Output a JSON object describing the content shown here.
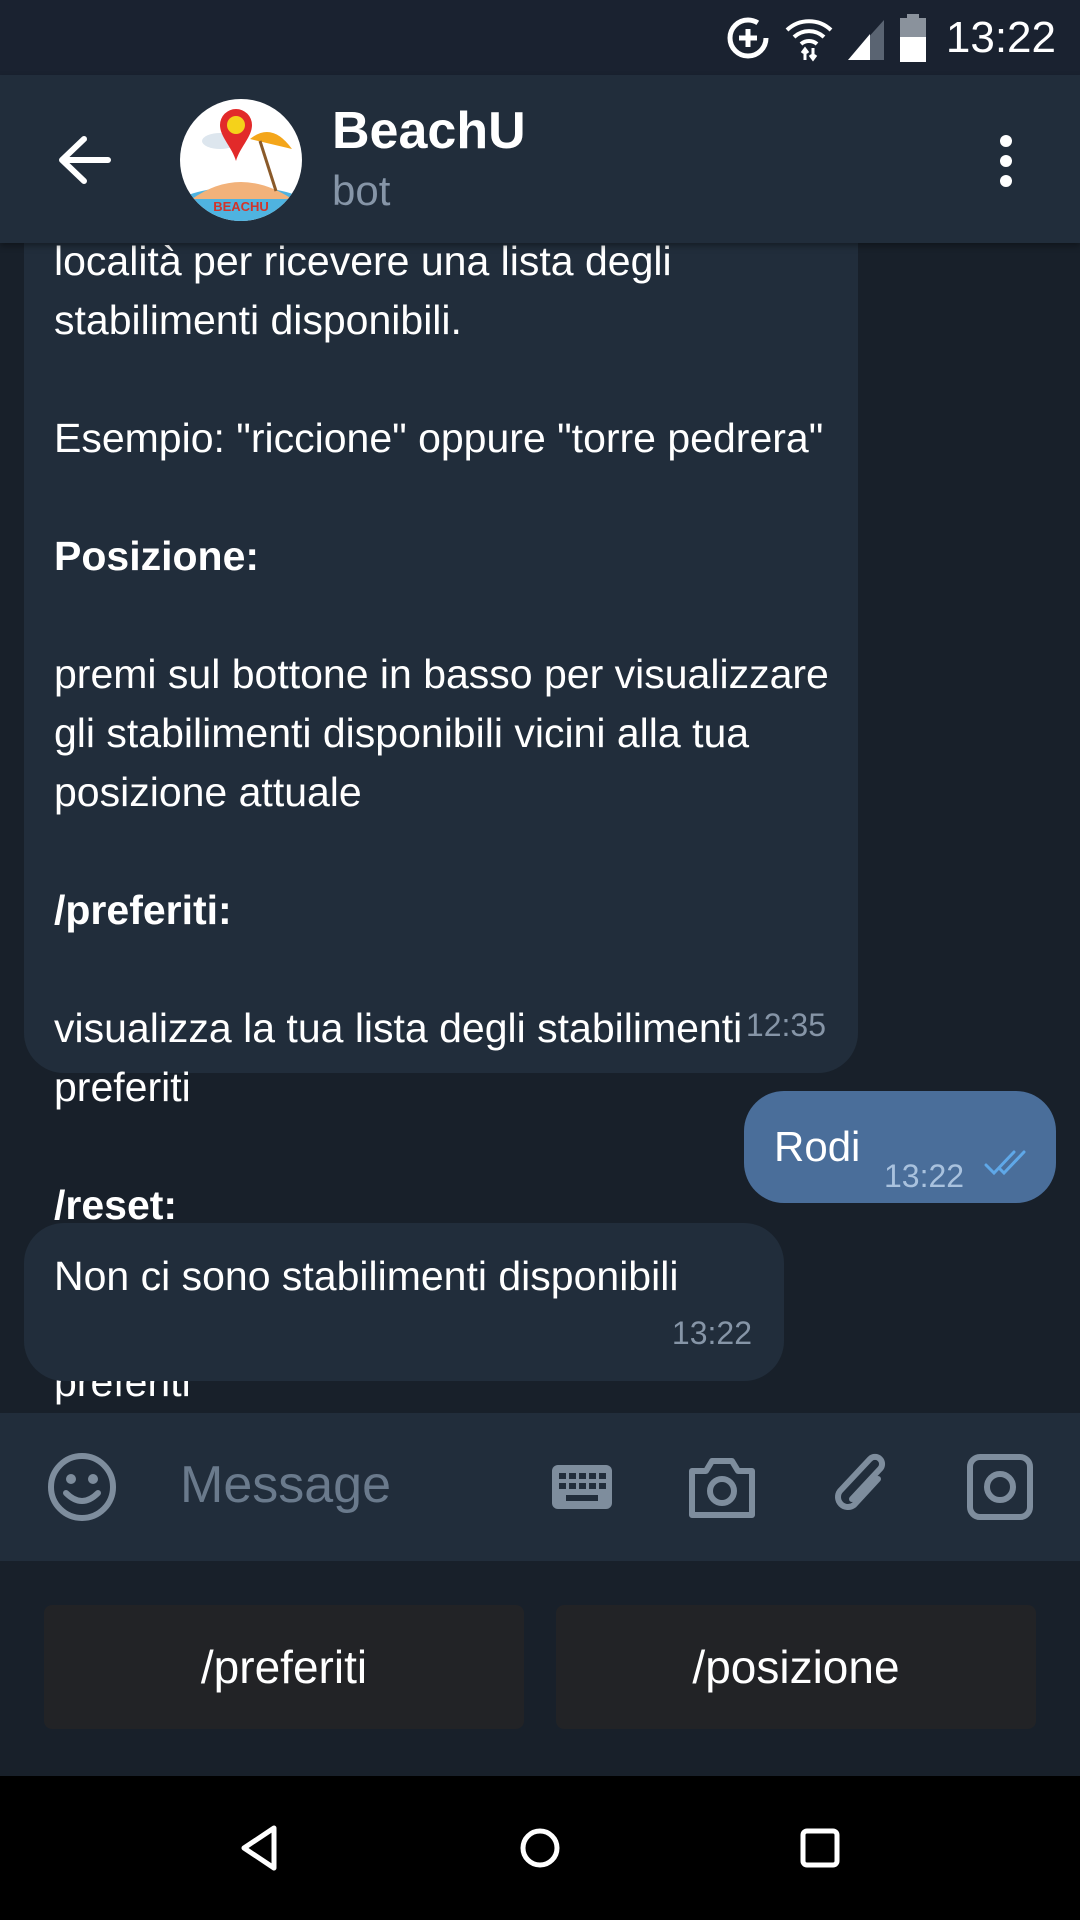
{
  "status_bar": {
    "time": "13:22"
  },
  "header": {
    "title": "BeachU",
    "subtitle": "bot",
    "avatar_text": "BEACHU"
  },
  "messages": [
    {
      "direction": "incoming",
      "lines": [
        {
          "text": "località per ricevere una lista degli stabilimenti disponibili.",
          "bold": false
        },
        {
          "text": "Esempio: \"riccione\" oppure \"torre pedrera\"",
          "bold": false
        },
        {
          "text": "Posizione:",
          "bold": true
        },
        {
          "text": "premi sul bottone in basso per visualizzare gli stabilimenti disponibili vicini alla tua posizione attuale",
          "bold": false
        },
        {
          "text": "/preferiti:",
          "bold": true
        },
        {
          "text": "visualizza la tua lista degli stabilimenti preferiti",
          "bold": false
        },
        {
          "text": "/reset:",
          "bold": true
        },
        {
          "text": "resetta la password per eccedere ai preferiti",
          "bold": false
        }
      ],
      "time": "12:35"
    },
    {
      "direction": "outgoing",
      "text": "Rodi",
      "time": "13:22",
      "status": "read"
    },
    {
      "direction": "incoming",
      "text": "Non ci sono stabilimenti disponibili",
      "time": "13:22"
    }
  ],
  "input": {
    "placeholder": "Message"
  },
  "keyboard": {
    "buttons": [
      "/preferiti",
      "/posizione"
    ]
  },
  "colors": {
    "background": "#18202a",
    "bubble_in": "#212d3b",
    "bubble_out": "#4a6e9a",
    "accent": "#5fa8e8"
  }
}
